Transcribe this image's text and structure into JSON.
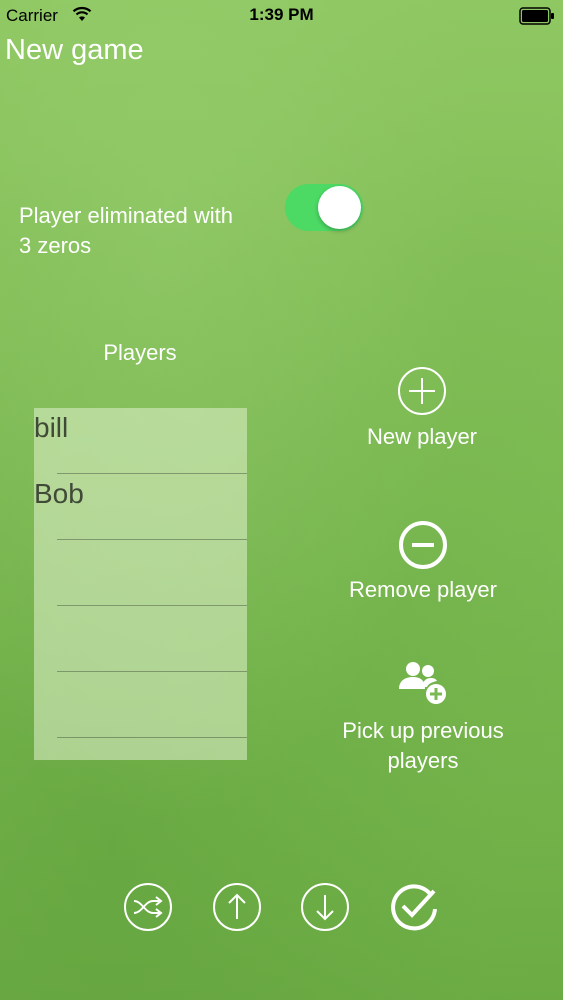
{
  "status_bar": {
    "carrier": "Carrier",
    "time": "1:39 PM"
  },
  "title": "New game",
  "settings": {
    "eliminate_label": "Player eliminated with 3 zeros",
    "eliminate_enabled": true
  },
  "players": {
    "header": "Players",
    "rows": [
      "bill",
      "Bob",
      "",
      "",
      ""
    ]
  },
  "actions": {
    "new_player": "New player",
    "remove_player": "Remove player",
    "pick_previous": "Pick up previous players"
  },
  "toolbar": {
    "buttons": [
      {
        "icon": "shuffle-icon"
      },
      {
        "icon": "arrow-up-icon"
      },
      {
        "icon": "arrow-down-icon"
      },
      {
        "icon": "checkmark-icon"
      }
    ]
  },
  "colors": {
    "toggle_on": "#4cd964",
    "text": "#ffffff"
  }
}
